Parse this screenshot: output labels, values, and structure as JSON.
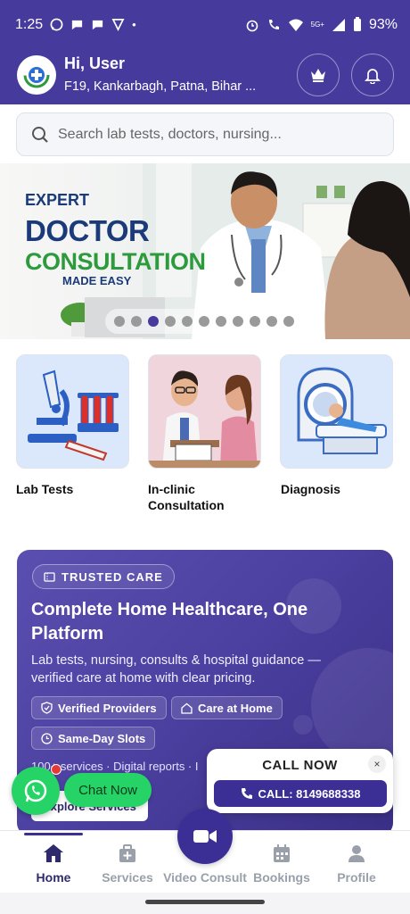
{
  "status_bar": {
    "time": "1:25",
    "battery": "93%",
    "signal_tag": "5G+"
  },
  "header": {
    "greeting": "Hi, User",
    "address": "F19, Kankarbagh, Patna, Bihar ..."
  },
  "search": {
    "placeholder": "Search lab tests, doctors, nursing..."
  },
  "banner": {
    "line1": "EXPERT",
    "line2": "DOCTOR",
    "line3": "CONSULTATION",
    "line4": "MADE EASY",
    "dot_count": 11,
    "active_dot": 2
  },
  "categories": [
    {
      "label": "Lab Tests"
    },
    {
      "label": "In-clinic Consultation"
    },
    {
      "label": "Diagnosis"
    }
  ],
  "care_card": {
    "badge": "TRUSTED CARE",
    "title": "Complete Home Healthcare, One Platform",
    "description": "Lab tests, nursing, consults & hospital guidance — verified care at home with clear pricing.",
    "chips": [
      "Verified Providers",
      "Care at Home",
      "Same-Day Slots"
    ],
    "meta": "100+ services · Digital reports · I",
    "cta": "Explore Services"
  },
  "whatsapp": {
    "label": "Chat Now"
  },
  "call_card": {
    "title": "CALL NOW",
    "close": "×",
    "button": "CALL: 8149688338"
  },
  "nav": {
    "items": [
      {
        "label": "Home",
        "icon": "home-icon"
      },
      {
        "label": "Services",
        "icon": "medical-bag-icon"
      },
      {
        "label": "Video Consult",
        "icon": "video-camera-icon"
      },
      {
        "label": "Bookings",
        "icon": "calendar-icon"
      },
      {
        "label": "Profile",
        "icon": "user-icon"
      }
    ],
    "active": "Home"
  },
  "colors": {
    "brand": "#463a9d",
    "accent_green": "#2d9a3c",
    "whatsapp": "#25d366"
  }
}
